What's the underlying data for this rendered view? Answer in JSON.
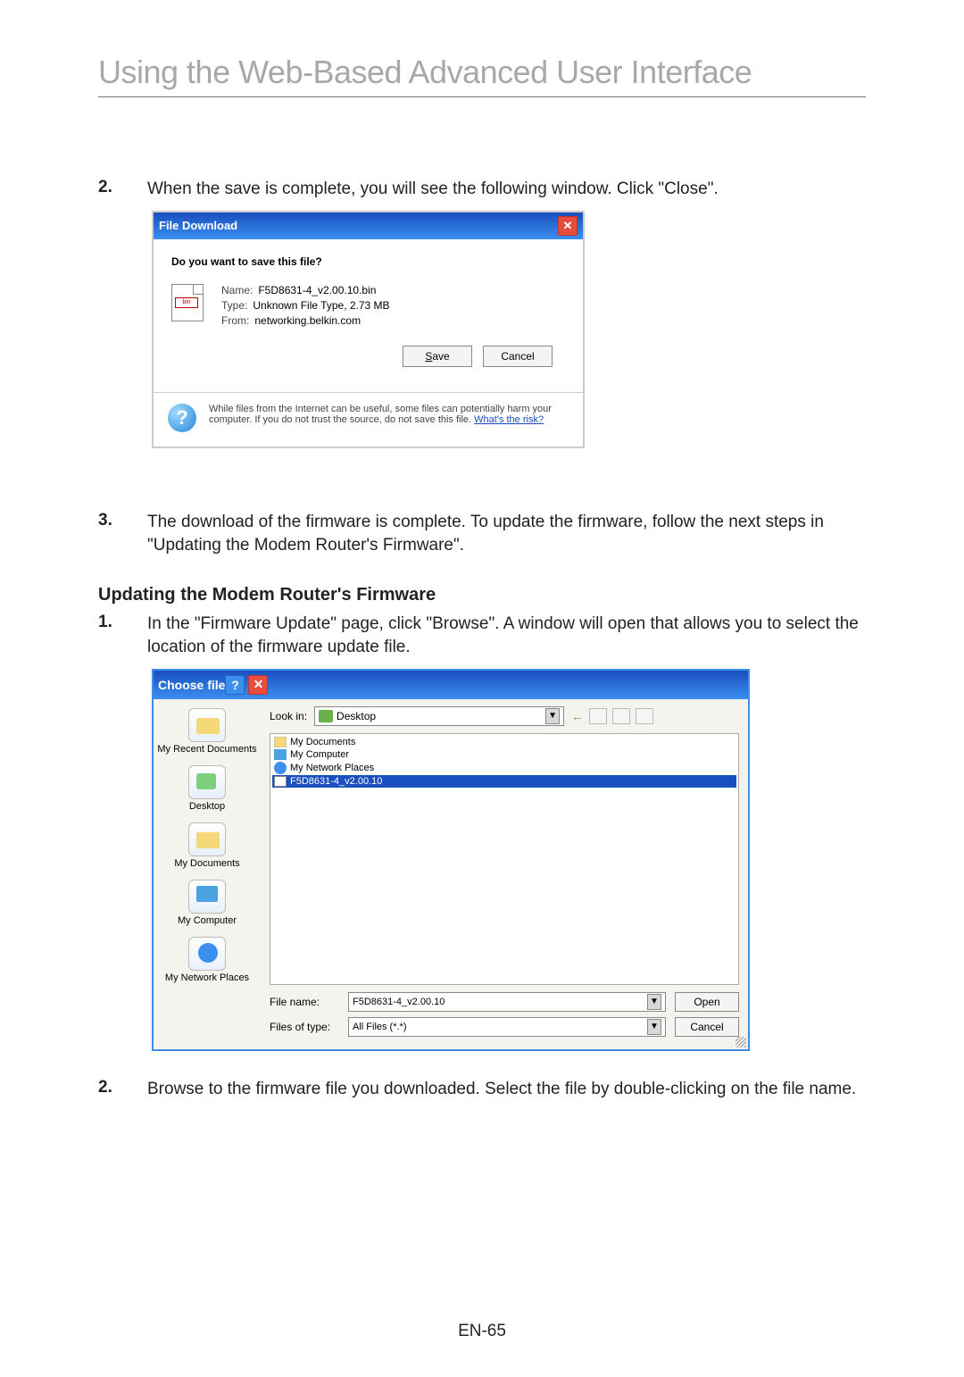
{
  "page": {
    "title": "Using the Web-Based Advanced User Interface",
    "footer": "EN-65"
  },
  "step2": {
    "num": "2.",
    "text": "When the save is complete, you will see the following window. Click \"Close\"."
  },
  "fileDownload": {
    "title": "File Download",
    "question": "Do you want to save this file?",
    "name_label": "Name:",
    "name_value": "F5D8631-4_v2.00.10.bin",
    "type_label": "Type:",
    "type_value": "Unknown File Type, 2.73 MB",
    "from_label": "From:",
    "from_value": "networking.belkin.com",
    "save": "Save",
    "cancel": "Cancel",
    "warning_pre": "While files from the Internet can be useful, some files can potentially harm your computer. If you do not trust the source, do not save this file. ",
    "warning_link": "What's the risk?"
  },
  "step3": {
    "num": "3.",
    "text": "The download of the firmware is complete. To update the firmware, follow the next steps in \"Updating the Modem Router's Firmware\"."
  },
  "section2": {
    "heading": "Updating the Modem Router's Firmware"
  },
  "s2step1": {
    "num": "1.",
    "text": "In the \"Firmware Update\" page, click \"Browse\". A window will open that allows you to select the location of the firmware update file."
  },
  "chooseFile": {
    "title": "Choose file",
    "lookin_label": "Look in:",
    "lookin_value": "Desktop",
    "sidebar": {
      "recent": "My Recent Documents",
      "desktop": "Desktop",
      "documents": "My Documents",
      "computer": "My Computer",
      "network": "My Network Places"
    },
    "list": {
      "mydocs": "My Documents",
      "mycomp": "My Computer",
      "mynet": "My Network Places",
      "file": "F5D8631-4_v2.00.10"
    },
    "filename_label": "File name:",
    "filename_value": "F5D8631-4_v2.00.10",
    "filetype_label": "Files of type:",
    "filetype_value": "All Files (*.*)",
    "open": "Open",
    "cancel": "Cancel"
  },
  "s2step2": {
    "num": "2.",
    "text": "Browse to the firmware file you downloaded. Select the file by double-clicking on the file name."
  }
}
